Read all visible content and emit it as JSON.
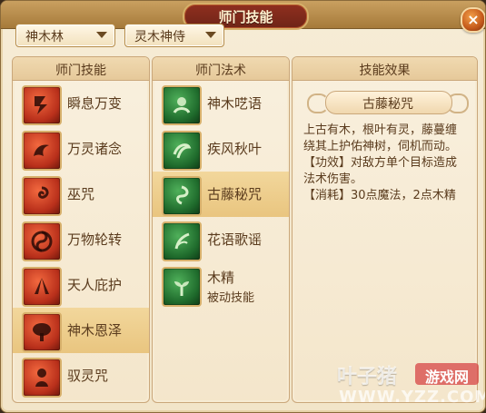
{
  "window": {
    "title": "师门技能",
    "close_label": "×"
  },
  "filters": {
    "school": "神木林",
    "category": "灵木神侍"
  },
  "columns": {
    "skills_header": "师门技能",
    "spells_header": "师门法术",
    "effect_header": "技能效果"
  },
  "skills": [
    {
      "name": "瞬息万变",
      "icon": "lightning-slash-icon"
    },
    {
      "name": "万灵诸念",
      "icon": "spirit-beast-icon"
    },
    {
      "name": "巫咒",
      "icon": "curse-swirl-icon"
    },
    {
      "name": "万物轮转",
      "icon": "yin-yang-wheel-icon"
    },
    {
      "name": "天人庇护",
      "icon": "praying-hands-icon"
    },
    {
      "name": "神木恩泽",
      "icon": "sacred-tree-icon",
      "selected": true
    },
    {
      "name": "驭灵咒",
      "icon": "spirit-control-icon"
    }
  ],
  "spells": [
    {
      "name": "神木呓语",
      "icon": "tree-whisper-icon"
    },
    {
      "name": "疾风秋叶",
      "icon": "wind-leaf-icon"
    },
    {
      "name": "古藤秘咒",
      "icon": "ancient-vine-icon",
      "selected": true
    },
    {
      "name": "花语歌谣",
      "icon": "flower-song-icon"
    },
    {
      "name": "木精",
      "subtitle": "被动技能",
      "icon": "wood-spirit-sprout-icon"
    }
  ],
  "effect": {
    "title": "古藤秘咒",
    "lines": [
      "上古有木，根叶有灵，藤蔓缠",
      "绕其上护佑神树，伺机而动。",
      "【功效】对敌方单个目标造成",
      "法术伤害。",
      "【消耗】30点魔法，2点木精"
    ]
  },
  "watermark": {
    "site": "叶子猪",
    "badge": "游戏网",
    "url": "WWW.YZZ.COM"
  },
  "colors": {
    "title_bg": "#6f2417",
    "panel_bg": "#f4e6cb",
    "selected_row": "#e9c57f",
    "text": "#5a3b1d"
  }
}
